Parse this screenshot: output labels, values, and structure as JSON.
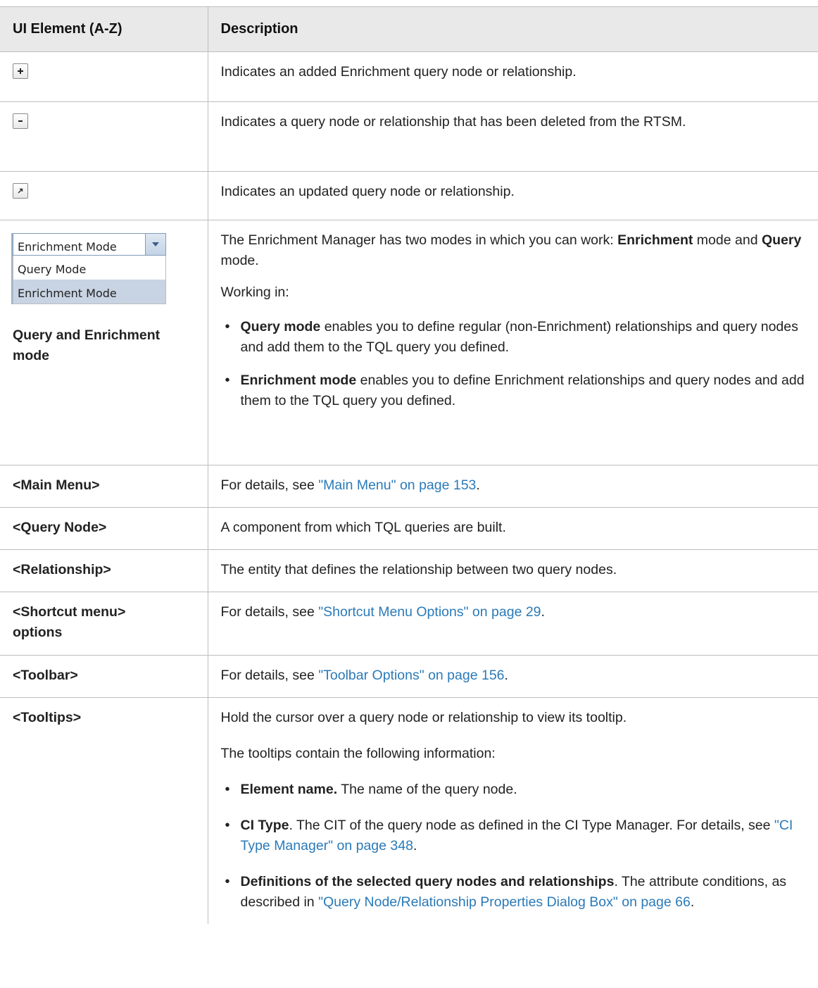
{
  "table": {
    "header": {
      "col1": "UI Element (A-Z)",
      "col2": "Description"
    },
    "rows": {
      "added": {
        "icon": "plus-icon",
        "desc": "Indicates an added Enrichment query node or relationship."
      },
      "deleted": {
        "icon": "minus-icon",
        "desc": "Indicates a query node or relationship that has been deleted from the RTSM."
      },
      "updated": {
        "icon": "updated-arrow-icon",
        "desc": "Indicates an updated query node or relationship."
      },
      "mode": {
        "dropdown_value": "Enrichment Mode",
        "options": [
          "Query Mode",
          "Enrichment Mode"
        ],
        "label": "Query and Enrichment mode",
        "desc_p1_a": "The Enrichment Manager has two modes in which you can work: ",
        "desc_p1_b": "Enrichment",
        "desc_p1_c": " mode and ",
        "desc_p1_d": "Query",
        "desc_p1_e": " mode.",
        "desc_p2": "Working in:",
        "bullet1_bold": "Query mode",
        "bullet1_text": " enables you to define regular (non-Enrichment) relationships and query nodes and add them to the TQL query you defined.",
        "bullet2_bold": "Enrichment mode",
        "bullet2_text": " enables you to define Enrichment relationships and query nodes and add them to the TQL query you defined."
      },
      "main_menu": {
        "label": "<Main Menu>",
        "prefix": "For details, see ",
        "link": "\"Main Menu\" on page 153",
        "suffix": "."
      },
      "query_node": {
        "label": "<Query Node>",
        "desc": "A component from which TQL queries are built."
      },
      "relationship": {
        "label": "<Relationship>",
        "desc": "The entity that defines the relationship between two query nodes."
      },
      "shortcut": {
        "label_a": "<Shortcut menu>",
        "label_b": "options",
        "prefix": "For details, see ",
        "link": "\"Shortcut Menu Options\" on page 29",
        "suffix": "."
      },
      "toolbar": {
        "label": "<Toolbar>",
        "prefix": "For details, see ",
        "link": "\"Toolbar Options\" on page 156",
        "suffix": "."
      },
      "tooltips": {
        "label": "<Tooltips>",
        "p1": "Hold the cursor over a query node or relationship to view its tooltip.",
        "p2": "The tooltips contain the following information:",
        "b1_bold": "Element name.",
        "b1_text": " The name of the query node.",
        "b2_bold": "CI Type",
        "b2_text": ". The CIT of the query node as defined in the CI Type Manager. For details, see ",
        "b2_link": "\"CI Type Manager\" on page 348",
        "b2_suffix": ".",
        "b3_bold": "Definitions of the selected query nodes and relationships",
        "b3_text": ". The attribute conditions, as described in ",
        "b3_link": "\"Query Node/Relationship Properties Dialog Box\" on page 66",
        "b3_suffix": "."
      }
    }
  }
}
